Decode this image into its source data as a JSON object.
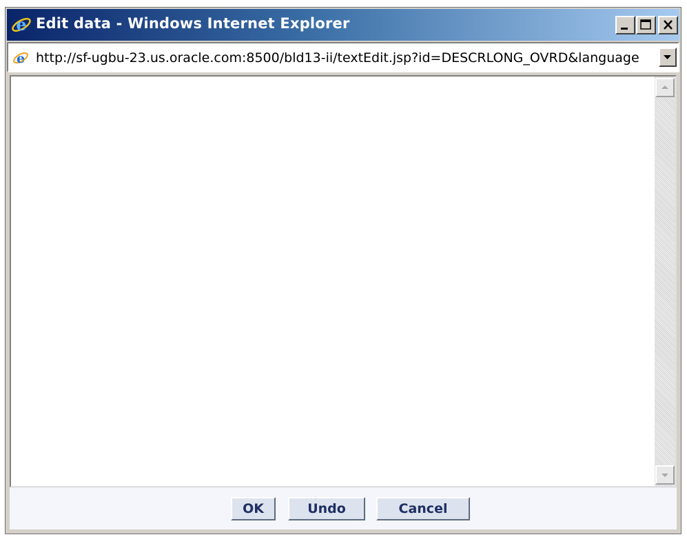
{
  "window": {
    "title": "Edit data - Windows Internet Explorer",
    "minimize_icon": "minimize-icon",
    "maximize_icon": "maximize-icon",
    "close_icon": "close-icon"
  },
  "address_bar": {
    "url": "http://sf-ugbu-23.us.oracle.com:8500/bld13-ii/textEdit.jsp?id=DESCRLONG_OVRD&language",
    "page_icon": "ie-page-icon",
    "dropdown_icon": "chevron-down-icon"
  },
  "editor": {
    "value": ""
  },
  "buttons": {
    "ok_label": "OK",
    "undo_label": "Undo",
    "cancel_label": "Cancel"
  },
  "colors": {
    "title_gradient_start": "#0a246a",
    "title_gradient_end": "#a6caf0",
    "button_text": "#1e2f63",
    "button_face": "#dde3ee"
  }
}
